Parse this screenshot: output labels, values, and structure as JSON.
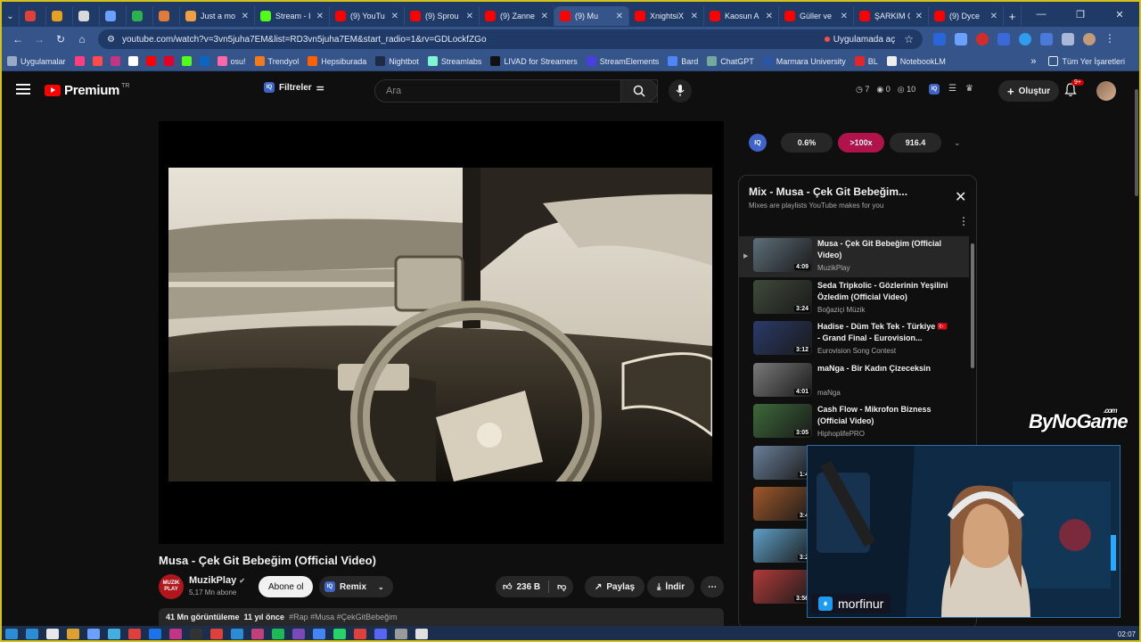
{
  "browser": {
    "tabs": [
      {
        "label": "",
        "favicon_color": "#e0403a",
        "pinned": true
      },
      {
        "label": "",
        "favicon_color": "#e8a020",
        "pinned": true
      },
      {
        "label": "",
        "favicon_color": "#d9d9d9",
        "pinned": true
      },
      {
        "label": "",
        "favicon_color": "#6aa1ff",
        "pinned": true
      },
      {
        "label": "",
        "favicon_color": "#2bb24c",
        "pinned": true
      },
      {
        "label": "",
        "favicon_color": "#e07b3a",
        "pinned": true
      },
      {
        "label": "Just a mo",
        "favicon_color": "#f0a040"
      },
      {
        "label": "Stream - I",
        "favicon_color": "#53fc18"
      },
      {
        "label": "(9) YouTu",
        "favicon_color": "#ff0000"
      },
      {
        "label": "(9) Sprou",
        "favicon_color": "#ff0000"
      },
      {
        "label": "(9) Zanne",
        "favicon_color": "#ff0000"
      },
      {
        "label": "(9) Mu",
        "favicon_color": "#ff0000",
        "active": true
      },
      {
        "label": "XnightsiX",
        "favicon_color": "#ff0000"
      },
      {
        "label": "Kaosun A",
        "favicon_color": "#ff0000"
      },
      {
        "label": "Güller ve",
        "favicon_color": "#ff0000"
      },
      {
        "label": "ŞARKIM Ç",
        "favicon_color": "#ff0000"
      },
      {
        "label": "(9) Dyce",
        "favicon_color": "#ff0000"
      }
    ],
    "new_tab": "+",
    "window_controls": {
      "minimize": "—",
      "restore": "❐",
      "close": "✕"
    },
    "url": "youtube.com/watch?v=3vn5juha7EM&list=RD3vn5juha7EM&start_radio=1&rv=GDLockfZGo",
    "open_in_app": "Uygulamada aç",
    "bookmarks": [
      {
        "label": "Uygulamalar",
        "color": "#9aa9c4"
      },
      {
        "label": "",
        "color": "#ff3d7f"
      },
      {
        "label": "",
        "color": "#ff4a4a"
      },
      {
        "label": "",
        "color": "#c13584"
      },
      {
        "label": "",
        "color": "#ffffff"
      },
      {
        "label": "",
        "color": "#ff0000"
      },
      {
        "label": "",
        "color": "#e60023"
      },
      {
        "label": "",
        "color": "#53fc18"
      },
      {
        "label": "",
        "color": "#0a66c2"
      },
      {
        "label": "osu!",
        "color": "#ff66aa"
      },
      {
        "label": "Trendyol",
        "color": "#f27a1a"
      },
      {
        "label": "Hepsiburada",
        "color": "#ff6000"
      },
      {
        "label": "Nightbot",
        "color": "#1f2a44"
      },
      {
        "label": "Streamlabs",
        "color": "#80f5d2"
      },
      {
        "label": "LIVAD for Streamers",
        "color": "#111111"
      },
      {
        "label": "StreamElements",
        "color": "#4a3ee0"
      },
      {
        "label": "Bard",
        "color": "#4f86f7"
      },
      {
        "label": "ChatGPT",
        "color": "#74aa9c"
      },
      {
        "label": "Marmara University",
        "color": "#2b56a8"
      },
      {
        "label": "BL",
        "color": "#e3262a"
      },
      {
        "label": "NotebookLM",
        "color": "#eeeeee"
      }
    ],
    "all_bookmarks": "Tüm Yer İşaretleri",
    "more_bookmarks": "»"
  },
  "youtube": {
    "logo_word": "Premium",
    "logo_sup": "TR",
    "filters_label": "Filtreler",
    "search_placeholder": "Ara",
    "counters": {
      "a": "7",
      "b": "0",
      "c": "10"
    },
    "create_label": "Oluştur",
    "notifications": "9+"
  },
  "extension": {
    "logo": "IQ",
    "chips": [
      "0.6%",
      ">100x",
      "916.4"
    ],
    "chip_colors": [
      "#272727",
      "#b0124a",
      "#272727"
    ]
  },
  "video": {
    "title": "Musa - Çek Git Bebeğim (Official Video)",
    "channel": "MuzikPlay",
    "channel_avatar_text": "MUZIK PLAY",
    "subscribers": "5,17 Mn abone",
    "subscribe": "Abone ol",
    "remix": "Remix",
    "likes": "236 B",
    "share": "Paylaş",
    "download": "İndir",
    "more": "⋯",
    "views": "41 Mn görüntüleme",
    "age": "11 yıl önce",
    "tags": "#Rap #Musa #ÇekGitBebeğim"
  },
  "playlist": {
    "title": "Mix - Musa - Çek Git Bebeğim...",
    "subtitle": "Mixes are playlists YouTube makes for you",
    "items": [
      {
        "title": "Musa - Çek Git Bebeğim (Official Video)",
        "channel": "MuzikPlay",
        "duration": "4:09",
        "thumb": "#5e6f7a",
        "now": true
      },
      {
        "title": "Seda Tripkolic - Gözlerinin Yeşilini Özledim (Official Video)",
        "channel": "Boğaziçi Müzik",
        "duration": "3:24",
        "thumb": "#3f4a3a"
      },
      {
        "title": "Hadise - Düm Tek Tek - Türkiye 🇹🇷 - Grand Final - Eurovision...",
        "channel": "Eurovision Song Contest",
        "duration": "3:12",
        "thumb": "#2a3a6a"
      },
      {
        "title": "maNga - Bir Kadın Çizeceksin",
        "channel": "maNga",
        "duration": "4:01",
        "thumb": "#7a7a7a"
      },
      {
        "title": "Cash Flow - Mikrofon Bizness (Official Video)",
        "channel": "HiphoplifePRO",
        "duration": "3:05",
        "thumb": "#3d6a3a"
      },
      {
        "title": "",
        "channel": "",
        "duration": "1:4",
        "thumb": "#6a7f9a"
      },
      {
        "title": "",
        "channel": "",
        "duration": "3:4",
        "thumb": "#a0582a"
      },
      {
        "title": "",
        "channel": "",
        "duration": "3:2",
        "thumb": "#5fa0c8"
      },
      {
        "title": "",
        "channel": "",
        "duration": "3:56",
        "thumb": "#b23a3a"
      }
    ]
  },
  "stream": {
    "watermark": "ByNoGame",
    "watermark_suffix": ".com",
    "streamer_tag": "morfinur"
  },
  "taskbar": {
    "icon_colors": [
      "#2b8cd6",
      "#2b8cd6",
      "#e8e8e8",
      "#e0a030",
      "#6aa1ff",
      "#3fb0e0",
      "#e0403a",
      "#1a73e8",
      "#c13584",
      "#333333",
      "#e0403a",
      "#2b8cd6",
      "#c0407a",
      "#1db954",
      "#7a4ab8",
      "#4285f4",
      "#25d366",
      "#e0403a",
      "#5865f2",
      "#9a9a9a",
      "#e0e0e0"
    ],
    "clock": "02:07"
  }
}
